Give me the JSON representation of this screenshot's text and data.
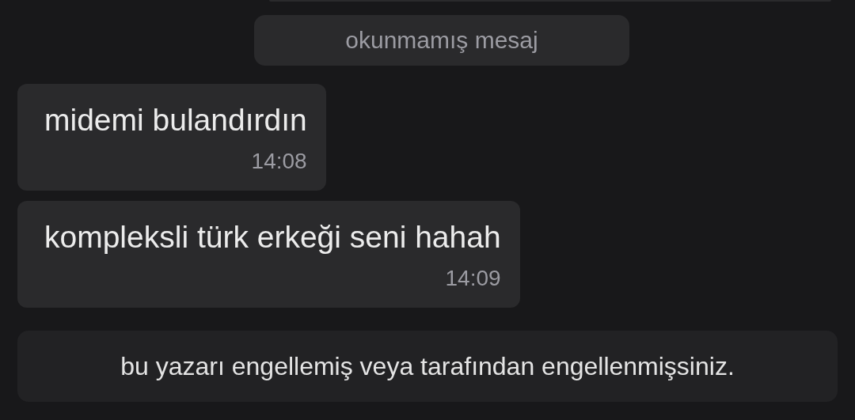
{
  "unread_divider": {
    "label": "okunmamış mesaj"
  },
  "messages": [
    {
      "text": "midemi bulandırdın",
      "time": "14:08"
    },
    {
      "text": "kompleksli türk erkeği seni hahah",
      "time": "14:09"
    }
  ],
  "notice": {
    "text": "bu yazarı engellemiş veya tarafından engellenmişsiniz."
  }
}
